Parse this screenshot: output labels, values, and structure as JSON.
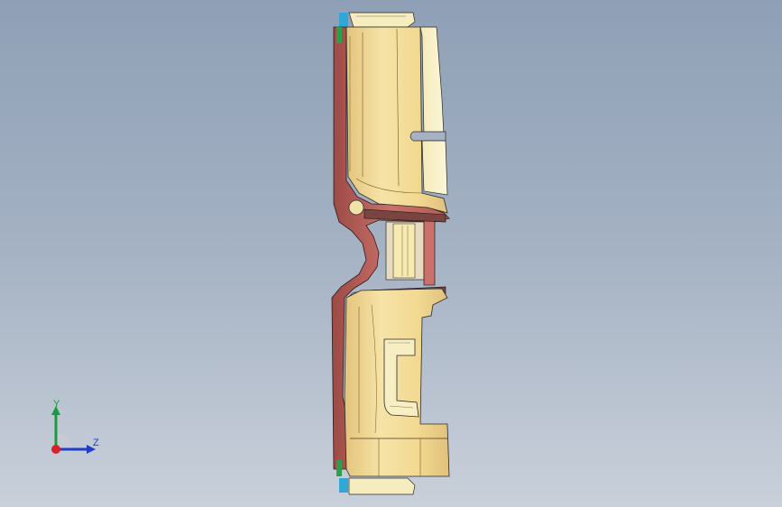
{
  "viewport": {
    "background_top": "#8fa0b6",
    "background_bottom": "#c9d0da"
  },
  "model": {
    "part_color": "#f4e6ac",
    "section_color": "#c76b63"
  },
  "triad": {
    "y_label": "Y",
    "z_label": "Z",
    "y_color": "#1a9b3c",
    "z_color": "#1f3fc8",
    "x_color": "#d8212a"
  }
}
